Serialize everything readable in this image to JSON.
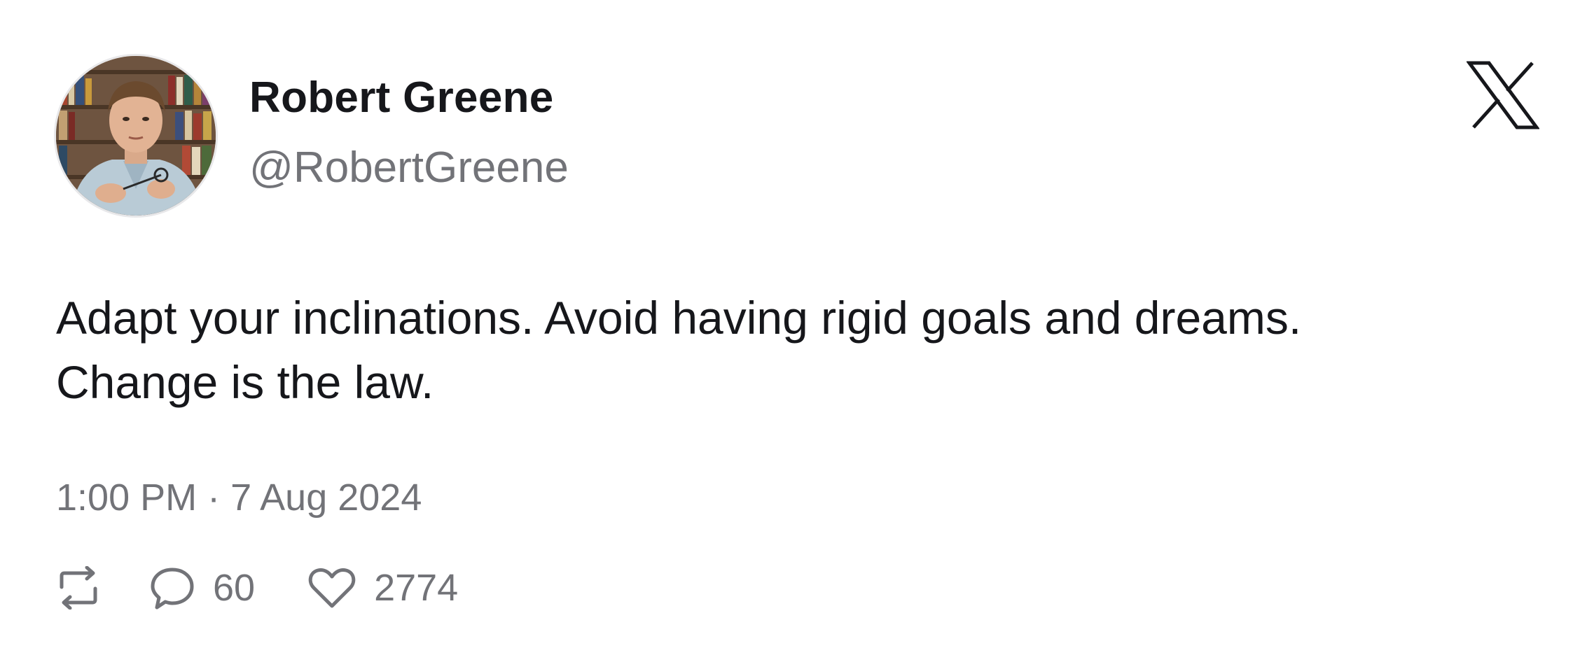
{
  "author": {
    "name": "Robert Greene",
    "handle": "@RobertGreene",
    "avatar_icon": "profile-photo"
  },
  "brand": {
    "icon": "x-logo-icon"
  },
  "tweet": {
    "text_lines": [
      "Adapt your inclinations. Avoid having rigid goals and dreams.",
      "Change is the law."
    ],
    "timestamp": "1:00 PM · 7 Aug 2024"
  },
  "metrics": {
    "retweet_icon": "retweet-icon",
    "reply_icon": "reply-icon",
    "reply_count": "60",
    "like_icon": "heart-icon",
    "like_count": "2774"
  },
  "colors": {
    "text_primary": "#16171b",
    "text_secondary": "#727378",
    "background": "#ffffff"
  }
}
